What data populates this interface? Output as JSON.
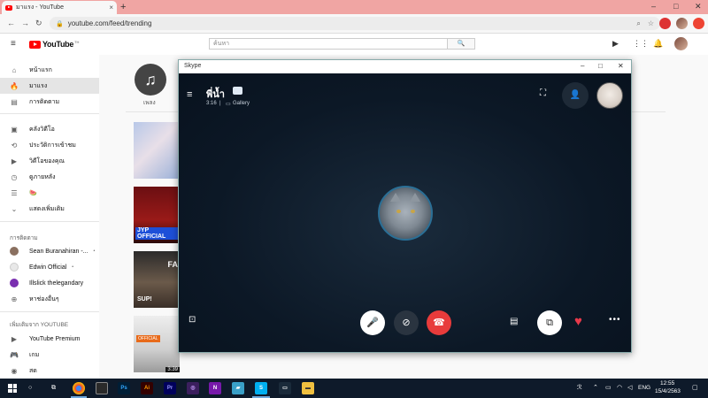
{
  "browser": {
    "tab_title": "มาแรง - YouTube",
    "url": "youtube.com/feed/trending",
    "new_tab_label": "+",
    "tab_close_label": "×"
  },
  "youtube": {
    "logo_text": "YouTube",
    "logo_sup": "TH",
    "search_placeholder": "ค้นหา",
    "sidebar": {
      "main_items": [
        {
          "label": "หน้าแรก",
          "icon": "home-icon",
          "active": false
        },
        {
          "label": "มาแรง",
          "icon": "trending-icon",
          "active": true
        },
        {
          "label": "การติดตาม",
          "icon": "subscriptions-icon",
          "active": false
        }
      ],
      "library_items": [
        {
          "label": "คลังวิดีโอ",
          "icon": "library-icon"
        },
        {
          "label": "ประวัติการเข้าชม",
          "icon": "history-icon"
        },
        {
          "label": "วิดีโอของคุณ",
          "icon": "your-videos-icon"
        },
        {
          "label": "ดูภายหลัง",
          "icon": "watch-later-icon"
        },
        {
          "label": "แสดงเพิ่มเติม",
          "icon": "chevron-down-icon"
        }
      ],
      "subscriptions_heading": "การติดตาม",
      "subscriptions": [
        {
          "label": "Sean Buranahiran -...",
          "dot": "•"
        },
        {
          "label": "Edwin Official",
          "dot": "•"
        },
        {
          "label": "Illslick thelegandary",
          "dot": ""
        },
        {
          "label": "หาช่องอื่นๆ",
          "dot": ""
        }
      ],
      "more_heading": "เพิ่มเติมจาก YOUTUBE",
      "more_items": [
        {
          "label": "YouTube Premium",
          "icon": "youtube-premium-icon"
        },
        {
          "label": "เกม",
          "icon": "gaming-icon"
        },
        {
          "label": "สด",
          "icon": "live-icon"
        }
      ]
    },
    "category_label": "เพลง",
    "thumbnails": [
      {
        "badge": ""
      },
      {
        "badge": "JYP OFFICIAL"
      },
      {
        "badge": "FA",
        "badge2": "SUP!"
      },
      {
        "badge": "OFFICIAL",
        "duration": "3:39"
      }
    ]
  },
  "skype": {
    "window_title": "Skype",
    "contact_name": "พี่น้ำ",
    "call_time": "3:16",
    "separator": "|",
    "view_mode": "Gallery"
  },
  "taskbar": {
    "apps": [
      {
        "label": "Ps",
        "bg": "#001e36",
        "fg": "#31a8ff"
      },
      {
        "label": "Ai",
        "bg": "#330000",
        "fg": "#ff9a00"
      },
      {
        "label": "Pr",
        "bg": "#00005b",
        "fg": "#9999ff"
      },
      {
        "label": "N",
        "bg": "#7719aa",
        "fg": "#ffffff"
      },
      {
        "label": "S",
        "bg": "#00aff0",
        "fg": "#ffffff"
      }
    ],
    "language": "ENG",
    "time": "12:55",
    "date": "15/4/2563"
  },
  "colors": {
    "tab_strip": "#f0a5a3",
    "skype_bg": "#0d1b2a",
    "hangup": "#e83b3b",
    "heart": "#e8394a"
  }
}
